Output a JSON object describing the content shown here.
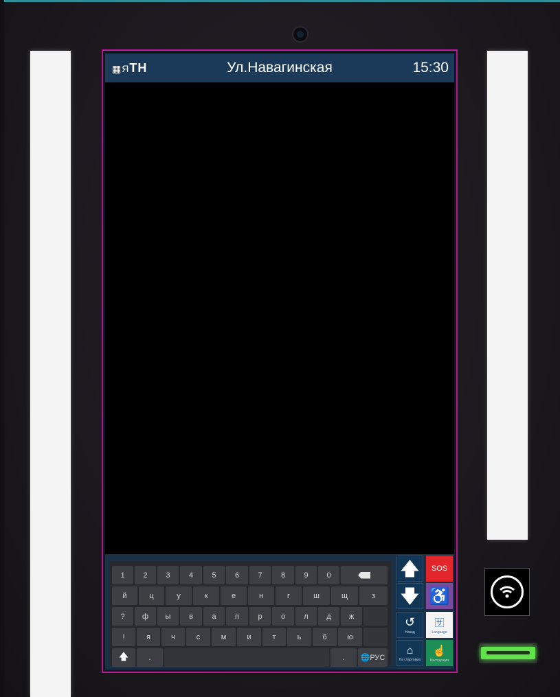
{
  "header": {
    "logo_prefix": "▦Я",
    "logo_text": "TH",
    "station": "Ул.Навагинская",
    "time": "15:30"
  },
  "keyboard": {
    "row1": [
      "1",
      "2",
      "3",
      "4",
      "5",
      "6",
      "7",
      "8",
      "9",
      "0"
    ],
    "row2": [
      "й",
      "ц",
      "у",
      "к",
      "е",
      "н",
      "г",
      "ш",
      "щ",
      "з"
    ],
    "row3": [
      "?",
      "ф",
      "ы",
      "в",
      "а",
      "п",
      "р",
      "о",
      "л",
      "д",
      "ж"
    ],
    "row4": [
      "!",
      "я",
      "ч",
      "с",
      "м",
      "и",
      "т",
      "ь",
      "б",
      "ю"
    ],
    "row5_left": ".",
    "row5_right": ".",
    "shift_icon": "shift-up-arrow",
    "backspace_icon": "backspace",
    "lang_label": "🌐РУС"
  },
  "side_buttons": {
    "up_icon": "arrow-up",
    "down_icon": "arrow-down",
    "back_label": "Назад",
    "home_label": "На стартовую",
    "sos_label": "SOS",
    "accessibility_icon": "wheelchair",
    "language_label": "Language",
    "instructions_label": "Инструкция"
  },
  "colors": {
    "header_bg": "#1b3a5a",
    "sos_red": "#e3262a",
    "accessibility_purple": "#7a4a9c",
    "instructions_green": "#1c8e56",
    "card_led_green": "#5fe24a",
    "bezel_magenta": "#b01a8c"
  }
}
